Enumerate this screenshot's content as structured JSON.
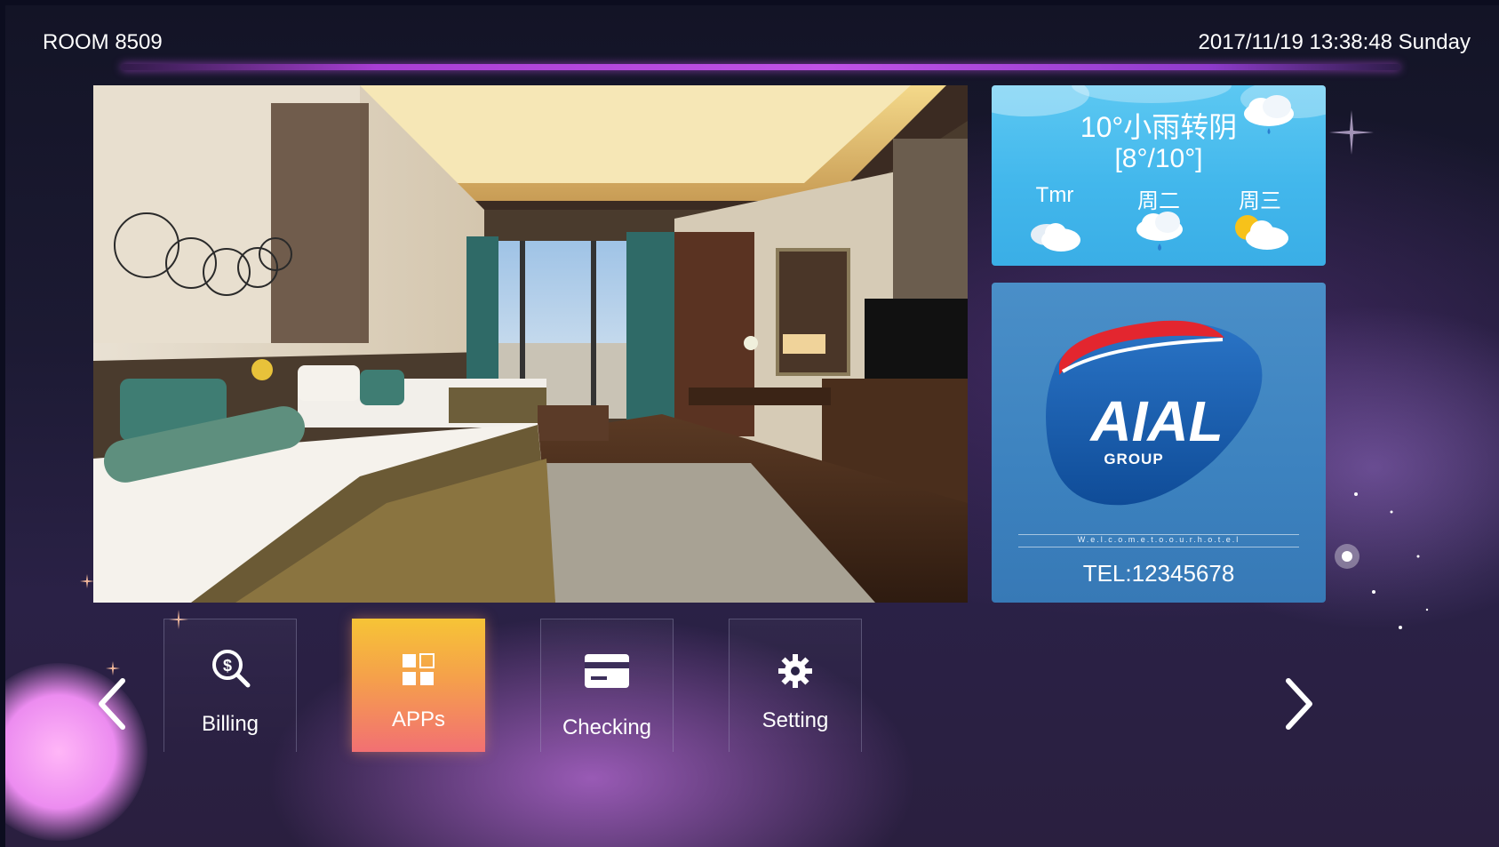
{
  "header": {
    "room": "ROOM 8509",
    "datetime": "2017/11/19  13:38:48  Sunday"
  },
  "weather": {
    "temperature": "10°小雨转阴",
    "range": "[8°/10°]",
    "forecast": [
      {
        "day": "Tmr",
        "icon": "cloudy-icon"
      },
      {
        "day": "周二",
        "icon": "rain-icon"
      },
      {
        "day": "周三",
        "icon": "partly-sunny-icon"
      }
    ]
  },
  "brand": {
    "name": "AIAL",
    "group": "GROUP",
    "tagline": "W.e.l.c.o.m.e.t.o.o.u.r.h.o.t.e.l",
    "tel": "TEL:12345678",
    "colors": {
      "red": "#e3262f",
      "blue": "#1e63b3"
    }
  },
  "nav": {
    "items": [
      {
        "label": "Billing",
        "icon": "billing-search-icon",
        "active": false
      },
      {
        "label": "APPs",
        "icon": "apps-grid-icon",
        "active": true
      },
      {
        "label": "Checking",
        "icon": "card-icon",
        "active": false
      },
      {
        "label": "Setting",
        "icon": "gear-icon",
        "active": false
      }
    ],
    "prev_icon": "chevron-left-icon",
    "next_icon": "chevron-right-icon"
  },
  "colors": {
    "accent_bar": "#b04ddc",
    "active_button_top": "#f6c436",
    "active_button_bottom": "#f27073",
    "weather_bg": "#4cbfef",
    "logo_panel_bg": "#4186c3"
  }
}
